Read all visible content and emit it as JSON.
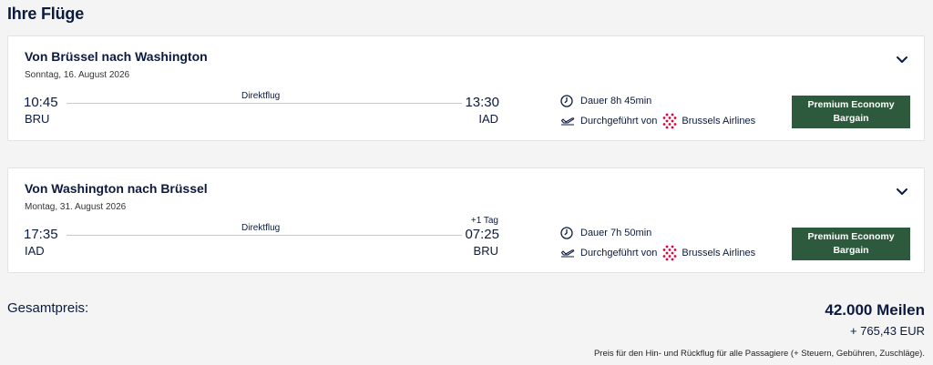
{
  "page": {
    "title": "Ihre Flüge"
  },
  "flights": [
    {
      "route": "Von Brüssel nach Washington",
      "date": "Sonntag, 16. August 2026",
      "departure_time": "10:45",
      "departure_code": "BRU",
      "arrival_time": "13:30",
      "arrival_code": "IAD",
      "next_day": "",
      "stops_label": "Direktflug",
      "duration": "Dauer 8h 45min",
      "operated_by": "Durchgeführt von",
      "airline": "Brussels Airlines",
      "fare_line1": "Premium Economy",
      "fare_line2": "Bargain"
    },
    {
      "route": "Von Washington nach Brüssel",
      "date": "Montag, 31. August 2026",
      "departure_time": "17:35",
      "departure_code": "IAD",
      "arrival_time": "07:25",
      "arrival_code": "BRU",
      "next_day": "+1 Tag",
      "stops_label": "Direktflug",
      "duration": "Dauer 7h 50min",
      "operated_by": "Durchgeführt von",
      "airline": "Brussels Airlines",
      "fare_line1": "Premium Economy",
      "fare_line2": "Bargain"
    }
  ],
  "total": {
    "label": "Gesamtpreis:",
    "miles": "42.000 Meilen",
    "eur": "+ 765,43 EUR",
    "note": "Preis für den Hin- und Rückflug für alle Passagiere (+ Steuern, Gebühren, Zuschläge)."
  },
  "colors": {
    "navy": "#0b1a3e",
    "fare_badge": "#2d5a3d",
    "airline_dots": "#e4003b"
  }
}
